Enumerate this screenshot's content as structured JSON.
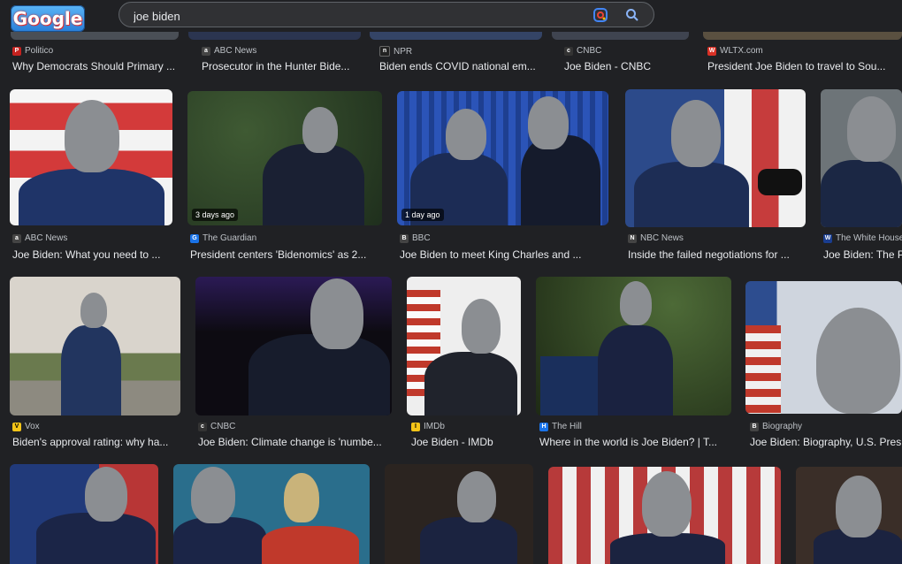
{
  "search": {
    "query": "joe biden",
    "logo_text": "Google"
  },
  "colors": {
    "background": "#202124",
    "text": "#e8eaed",
    "source_text": "#bdc1c6"
  },
  "row0": [
    {
      "source": "Politico",
      "title": "Why Democrats Should Primary ...",
      "fav_color": "#c5221f",
      "fav_icon": "P"
    },
    {
      "source": "ABC News",
      "title": "Prosecutor in the Hunter Bide...",
      "fav_color": "#444",
      "fav_icon": "a"
    },
    {
      "source": "NPR",
      "title": "Biden ends COVID national em...",
      "fav_color": "#222",
      "fav_icon": "n"
    },
    {
      "source": "CNBC",
      "title": "Joe Biden - CNBC",
      "fav_color": "#333",
      "fav_icon": "c"
    },
    {
      "source": "WLTX.com",
      "title": "President Joe Biden to travel to Sou...",
      "fav_color": "#d93025",
      "fav_icon": "W"
    }
  ],
  "row1": [
    {
      "source": "ABC News",
      "title": "Joe Biden: What you need to ...",
      "fav_color": "#444",
      "fav_icon": "a",
      "badge": ""
    },
    {
      "source": "The Guardian",
      "title": "President centers 'Bidenomics' as 2...",
      "fav_color": "#1a73e8",
      "fav_icon": "G",
      "badge": "3 days ago"
    },
    {
      "source": "BBC",
      "title": "Joe Biden to meet King Charles and ...",
      "fav_color": "#444",
      "fav_icon": "B",
      "badge": "1 day ago"
    },
    {
      "source": "NBC News",
      "title": "Inside the failed negotiations for ...",
      "fav_color": "#444",
      "fav_icon": "N",
      "badge": ""
    },
    {
      "source": "The White House",
      "title": "Joe Biden: The P",
      "fav_color": "#1a3d8f",
      "fav_icon": "W",
      "badge": ""
    }
  ],
  "row2": [
    {
      "source": "Vox",
      "title": "Biden's approval rating: why ha...",
      "fav_color": "#f5c518",
      "fav_icon": "V"
    },
    {
      "source": "CNBC",
      "title": "Joe Biden: Climate change is 'numbe...",
      "fav_color": "#333",
      "fav_icon": "c"
    },
    {
      "source": "IMDb",
      "title": "Joe Biden - IMDb",
      "fav_color": "#f5c518",
      "fav_icon": "I"
    },
    {
      "source": "The Hill",
      "title": "Where in the world is Joe Biden? | T...",
      "fav_color": "#1a73e8",
      "fav_icon": "H"
    },
    {
      "source": "Biography",
      "title": "Joe Biden: Biography, U.S. Presi",
      "fav_color": "#444",
      "fav_icon": "B"
    }
  ]
}
